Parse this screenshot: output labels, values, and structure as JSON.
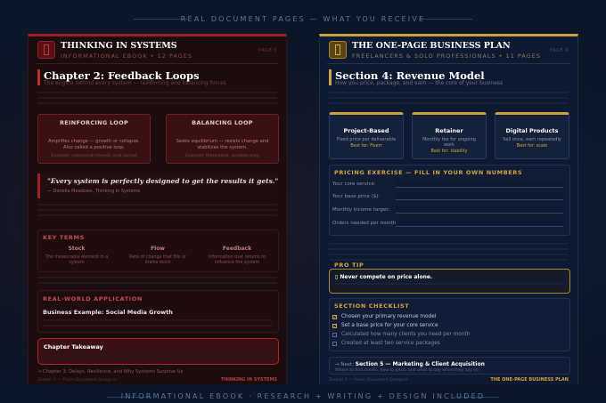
{
  "captions": {
    "top": "REAL DOCUMENT PAGES — WHAT YOU RECEIVE",
    "bottom": "INFORMATIONAL EBOOK · RESEARCH + WRITING + DESIGN INCLUDED"
  },
  "left_page": {
    "accent_color": "#a11f24",
    "book_title": "THINKING IN SYSTEMS",
    "book_subtitle": "INFORMATIONAL EBOOK • 12 PAGES",
    "page_label": "PAGE 5",
    "chapter_title": "Chapter 2: Feedback Loops",
    "chapter_subtitle": "The engine behind every system — reinforcing and balancing forces",
    "loops": [
      {
        "title": "REINFORCING LOOP",
        "desc": "Amplifies change — growth or collapse. Also called a positive loop.",
        "example": "Example: compound interest, viral spread"
      },
      {
        "title": "BALANCING LOOP",
        "desc": "Seeks equilibrium — resists change and stabilizes the system.",
        "example": "Example: thermostat, predator-prey"
      }
    ],
    "quote": "\"Every system is perfectly designed to get the results it gets.\"",
    "quote_author": "— Donella Meadows, Thinking in Systems",
    "key_terms_label": "KEY TERMS",
    "terms": [
      {
        "title": "Stock",
        "desc": "The measurable element in a system"
      },
      {
        "title": "Flow",
        "desc": "Rate of change that fills or drains stock"
      },
      {
        "title": "Feedback",
        "desc": "Information that returns to influence the system"
      }
    ],
    "application_label": "REAL-WORLD APPLICATION",
    "example_title": "Business Example: Social Media Growth",
    "takeaway_title": "Chapter Takeaway",
    "next_chapter": "→ Chapter 3: Delays, Resilience, and Why Systems Surprise Us",
    "footer_left": "Zeebar Y. — Fiverr Document Designer",
    "footer_right": "THINKING IN SYSTEMS"
  },
  "right_page": {
    "accent_color": "#c9a23a",
    "book_title": "THE ONE-PAGE BUSINESS PLAN",
    "book_subtitle": "FREELANCERS & SOLO PROFESSIONALS • 11 PAGES",
    "page_label": "PAGE 6",
    "section_title": "Section 4: Revenue Model",
    "section_subtitle": "How you price, package, and earn — the core of your business",
    "plans": [
      {
        "title": "Project-Based",
        "desc": "Fixed price per deliverable",
        "best": "Best for: Fiverr"
      },
      {
        "title": "Retainer",
        "desc": "Monthly fee for ongoing work",
        "best": "Best for: stability"
      },
      {
        "title": "Digital Products",
        "desc": "Sell once, earn repeatedly",
        "best": "Best for: scale"
      }
    ],
    "exercise_label": "PRICING EXERCISE — FILL IN YOUR OWN NUMBERS",
    "fields": [
      "Your core service:",
      "Your base price ($):",
      "Monthly income target:",
      "Orders needed per month:"
    ],
    "tip_label": "PRO TIP",
    "tip_text": "▯ Never compete on price alone.",
    "checklist_label": "SECTION CHECKLIST",
    "checklist": [
      {
        "text": "Chosen your primary revenue model",
        "done": true
      },
      {
        "text": "Set a base price for your core service",
        "done": true
      },
      {
        "text": "Calculated how many clients you need per month",
        "done": false
      },
      {
        "text": "Created at least two service packages",
        "done": false
      }
    ],
    "next_prefix": "→ Next:",
    "next_title": "Section 5 — Marketing & Client Acquisition",
    "next_sub": "Where to find clients, how to pitch, and what to say when they say no",
    "footer_left": "Zeebar Y. — Fiverr Document Designer",
    "footer_right": "THE ONE-PAGE BUSINESS PLAN"
  }
}
